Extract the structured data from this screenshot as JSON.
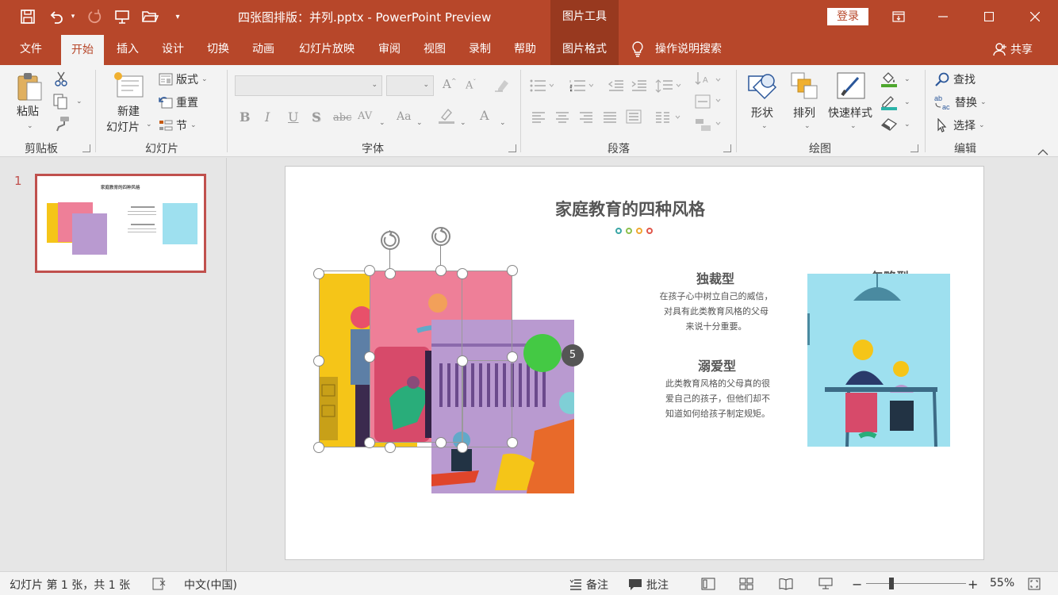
{
  "titlebar": {
    "doc_title": "四张图排版：并列.pptx  -  PowerPoint Preview",
    "tool_group": "图片工具",
    "login": "登录",
    "accent": "#b7472a"
  },
  "tabs": [
    {
      "label": "文件"
    },
    {
      "label": "开始"
    },
    {
      "label": "插入"
    },
    {
      "label": "设计"
    },
    {
      "label": "切换"
    },
    {
      "label": "动画"
    },
    {
      "label": "幻灯片放映"
    },
    {
      "label": "审阅"
    },
    {
      "label": "视图"
    },
    {
      "label": "录制"
    },
    {
      "label": "帮助"
    },
    {
      "label": "图片格式"
    }
  ],
  "tell_me": "操作说明搜索",
  "share": "共享",
  "ribbon": {
    "clipboard": {
      "paste": "粘贴",
      "group": "剪贴板"
    },
    "slides": {
      "new_slide_1": "新建",
      "new_slide_2": "幻灯片",
      "layout": "版式",
      "reset": "重置",
      "section": "节",
      "group": "幻灯片"
    },
    "font": {
      "group": "字体",
      "bold": "B",
      "italic": "I",
      "underline": "U",
      "shadow": "S",
      "strike": "abc",
      "spacing": "AV",
      "case": "Aa",
      "color": "A"
    },
    "paragraph": {
      "group": "段落"
    },
    "drawing": {
      "shapes": "形状",
      "arrange": "排列",
      "quick_styles": "快速样式",
      "group": "绘图"
    },
    "editing": {
      "find": "查找",
      "replace": "替换",
      "select": "选择",
      "group": "编辑"
    }
  },
  "thumbnails": [
    {
      "number": "1",
      "title": "家庭教育的四种风格"
    }
  ],
  "slide": {
    "title": "家庭教育的四种风格",
    "dot_colors": [
      "#3aa6a6",
      "#8cc04b",
      "#f0a830",
      "#e0564a"
    ],
    "styles": [
      {
        "heading": "独裁型",
        "lines": [
          "在孩子心中树立自己的威信，",
          "对具有此类教育风格的父母",
          "来说十分重要。"
        ]
      },
      {
        "heading": "溺爱型",
        "lines": [
          "此类教育风格的父母真的很",
          "爱自己的孩子，但他们却不",
          "知道如何给孩子制定规矩。"
        ]
      },
      {
        "heading": "忽略型"
      }
    ],
    "selection_count": "5"
  },
  "statusbar": {
    "slide_info": "幻灯片 第 1 张，共 1 张",
    "language": "中文(中国)",
    "notes": "备注",
    "comments": "批注",
    "zoom": "55%",
    "zoom_level": 0.55
  }
}
